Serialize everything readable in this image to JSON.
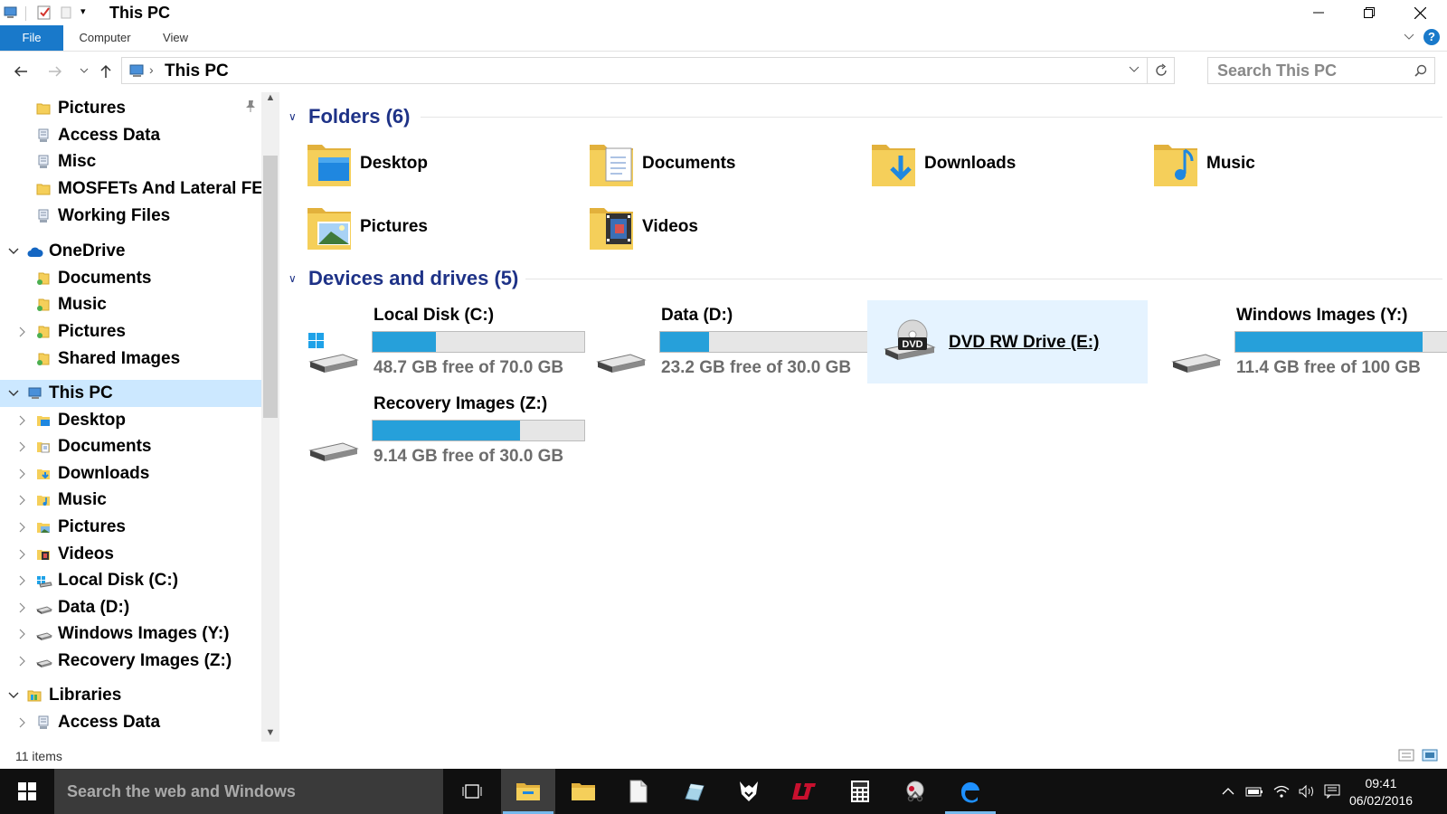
{
  "window": {
    "title": "This PC"
  },
  "ribbon": {
    "tabs": [
      "File",
      "Computer",
      "View"
    ],
    "help_glyph": "?"
  },
  "address": {
    "crumb": "This PC",
    "search_placeholder": "Search This PC"
  },
  "nav_tree": [
    {
      "label": "Pictures",
      "icon": "folder-icon",
      "level": 1,
      "chevron": "",
      "pinned": true
    },
    {
      "label": "Access Data",
      "icon": "network-folder-icon",
      "level": 1,
      "chevron": ""
    },
    {
      "label": "Misc",
      "icon": "network-folder-icon",
      "level": 1,
      "chevron": ""
    },
    {
      "label": "MOSFETs And Lateral FE",
      "icon": "folder-icon",
      "level": 1,
      "chevron": ""
    },
    {
      "label": "Working Files",
      "icon": "network-folder-icon",
      "level": 1,
      "chevron": ""
    },
    {
      "label": "OneDrive",
      "icon": "cloud-icon",
      "level": 0,
      "chevron": "expanded"
    },
    {
      "label": "Documents",
      "icon": "onedrive-folder-icon",
      "level": 1,
      "chevron": ""
    },
    {
      "label": "Music",
      "icon": "onedrive-folder-icon",
      "level": 1,
      "chevron": ""
    },
    {
      "label": "Pictures",
      "icon": "onedrive-folder-icon",
      "level": 1,
      "chevron": "collapsed"
    },
    {
      "label": "Shared Images",
      "icon": "onedrive-folder-icon",
      "level": 1,
      "chevron": ""
    },
    {
      "label": "This PC",
      "icon": "computer-icon",
      "level": 0,
      "chevron": "expanded",
      "selected": true
    },
    {
      "label": "Desktop",
      "icon": "desktop-folder-icon",
      "level": 1,
      "chevron": "collapsed"
    },
    {
      "label": "Documents",
      "icon": "documents-folder-icon",
      "level": 1,
      "chevron": "collapsed"
    },
    {
      "label": "Downloads",
      "icon": "downloads-folder-icon",
      "level": 1,
      "chevron": "collapsed"
    },
    {
      "label": "Music",
      "icon": "music-folder-icon",
      "level": 1,
      "chevron": "collapsed"
    },
    {
      "label": "Pictures",
      "icon": "pictures-folder-icon",
      "level": 1,
      "chevron": "collapsed"
    },
    {
      "label": "Videos",
      "icon": "videos-folder-icon",
      "level": 1,
      "chevron": "collapsed"
    },
    {
      "label": "Local Disk (C:)",
      "icon": "windows-drive-icon",
      "level": 1,
      "chevron": "collapsed"
    },
    {
      "label": "Data (D:)",
      "icon": "drive-icon",
      "level": 1,
      "chevron": "collapsed"
    },
    {
      "label": "Windows Images (Y:)",
      "icon": "drive-icon",
      "level": 1,
      "chevron": "collapsed"
    },
    {
      "label": "Recovery Images (Z:)",
      "icon": "drive-icon",
      "level": 1,
      "chevron": "collapsed"
    },
    {
      "label": "Libraries",
      "icon": "libraries-icon",
      "level": 0,
      "chevron": "expanded"
    },
    {
      "label": "Access Data",
      "icon": "network-folder-icon",
      "level": 1,
      "chevron": "collapsed"
    }
  ],
  "folders_group": {
    "title": "Folders (6)",
    "items": [
      {
        "name": "Desktop",
        "icon": "desktop-folder-icon"
      },
      {
        "name": "Documents",
        "icon": "documents-folder-icon"
      },
      {
        "name": "Downloads",
        "icon": "downloads-folder-icon"
      },
      {
        "name": "Music",
        "icon": "music-folder-icon"
      },
      {
        "name": "Pictures",
        "icon": "pictures-folder-icon"
      },
      {
        "name": "Videos",
        "icon": "videos-folder-icon"
      }
    ]
  },
  "drives_group": {
    "title": "Devices and drives (5)",
    "items": [
      {
        "name": "Local Disk (C:)",
        "free": "48.7 GB free of 70.0 GB",
        "used_fraction": 0.3,
        "icon": "windows-drive-icon",
        "has_bar": true
      },
      {
        "name": "Data (D:)",
        "free": "23.2 GB free of 30.0 GB",
        "used_fraction": 0.23,
        "icon": "drive-icon",
        "has_bar": true
      },
      {
        "name": "DVD RW Drive (E:)",
        "free": "",
        "used_fraction": 0,
        "icon": "dvd-drive-icon",
        "has_bar": false,
        "hover": true
      },
      {
        "name": "Windows Images (Y:)",
        "free": "11.4 GB free of 100 GB",
        "used_fraction": 0.886,
        "icon": "drive-icon",
        "has_bar": true
      },
      {
        "name": "Recovery Images (Z:)",
        "free": "9.14 GB free of 30.0 GB",
        "used_fraction": 0.695,
        "icon": "drive-icon",
        "has_bar": true
      }
    ],
    "dvd_label": "DVD"
  },
  "status": {
    "items_count": "11 items"
  },
  "taskbar": {
    "search_placeholder": "Search the web and Windows",
    "apps": [
      "task-view-icon",
      "file-explorer-icon",
      "folder-icon",
      "notepad-icon",
      "paint-icon",
      "foxit-icon",
      "ltspice-icon",
      "calculator-icon",
      "snipping-icon",
      "edge-icon"
    ],
    "time": "09:41",
    "date": "06/02/2016"
  },
  "colors": {
    "accent": "#1979ca",
    "group_heading": "#1e3287",
    "drive_bar": "#26a0da",
    "selection": "#cce8ff",
    "hover": "#e5f3ff"
  }
}
